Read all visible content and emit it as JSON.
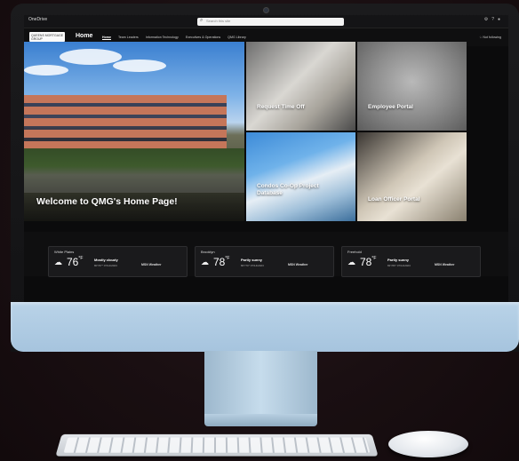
{
  "topbar": {
    "app_name": "OneDrive",
    "search_placeholder": "Search this site",
    "icons": [
      "gear-icon",
      "help-icon",
      "avatar-icon"
    ]
  },
  "nav": {
    "logo_text": "QUEENS MORTGAGE GROUP",
    "site_title": "Home",
    "links": [
      {
        "label": "Home",
        "active": true
      },
      {
        "label": "Team Leaders"
      },
      {
        "label": "Information Technology"
      },
      {
        "label": "Executives & Operations"
      },
      {
        "label": "QMG Library"
      }
    ],
    "following": "☆ Not following"
  },
  "hero": {
    "main_label": "Welcome to QMG's Home Page!",
    "tiles": [
      {
        "label": "Request Time Off"
      },
      {
        "label": "Employee Portal"
      },
      {
        "label": "Condos Co-Op Project Database"
      },
      {
        "label": "Loan Officer Portal"
      }
    ]
  },
  "weather": [
    {
      "city": "White Plains",
      "temp": "76",
      "unit": "°F",
      "condition": "Mostly cloudy",
      "hilo": "80°/67°   07/14/2023",
      "source": "MSN Weather"
    },
    {
      "city": "Brooklyn",
      "temp": "78",
      "unit": "°F",
      "condition": "Partly sunny",
      "hilo": "80°/70°   07/14/2023",
      "source": "MSN Weather"
    },
    {
      "city": "Freehold",
      "temp": "78",
      "unit": "°F",
      "condition": "Partly sunny",
      "hilo": "82°/66°   07/14/2023",
      "source": "MSN Weather"
    }
  ],
  "colors": {
    "bezel": "#121214",
    "chin": "#a6c4de",
    "screen_bg": "#0b0b0c",
    "card_bg": "#1a1a1c"
  }
}
